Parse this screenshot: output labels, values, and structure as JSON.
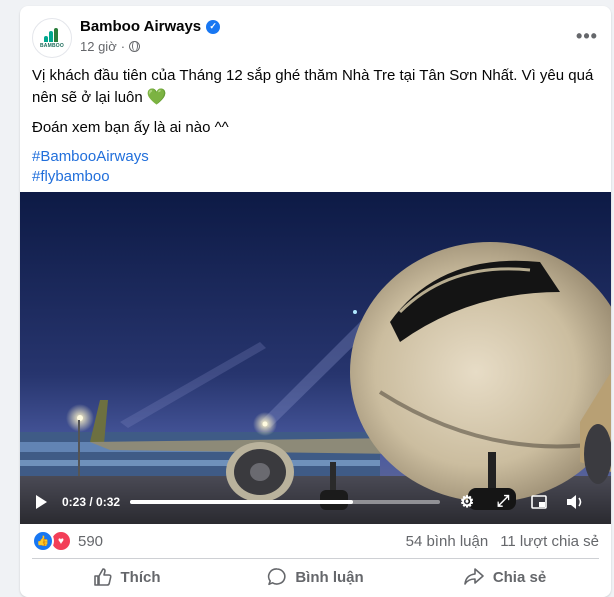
{
  "post": {
    "page_name": "Bamboo Airways",
    "logo_text": "BAMBOO",
    "time": "12 giờ",
    "separator": "·",
    "more": "•••",
    "text_line1": "Vị khách đầu tiên của Tháng 12 sắp ghé thăm Nhà Tre tại Tân Sơn Nhất. Vì yêu quá nên sẽ ở lại luôn",
    "heart": "💚",
    "text_line2": "Đoán xem bạn ấy là ai nào ^^",
    "hashtags": [
      "#BambooAirways",
      "#flybamboo"
    ]
  },
  "video": {
    "current_time": "0:23",
    "duration": "0:32",
    "time_display": "0:23 / 0:32",
    "progress": 0.72
  },
  "stats": {
    "reactions_count": "590",
    "comments": "54 bình luận",
    "shares": "11 lượt chia sẻ"
  },
  "actions": {
    "like": "Thích",
    "comment": "Bình luận",
    "share": "Chia sẻ"
  },
  "icons": [
    "verified-badge-icon",
    "globe-icon",
    "more-options-icon",
    "play-icon",
    "settings-icon",
    "fullscreen-icon",
    "pip-icon",
    "volume-icon",
    "like-reaction-icon",
    "love-reaction-icon",
    "thumbs-up-icon",
    "comment-icon",
    "share-icon"
  ],
  "colors": {
    "accent_blue": "#1877f2",
    "hashtag": "#216fdb",
    "secondary_text": "#65676b",
    "love": "#f33e58",
    "heart_green": "#2ebd3f"
  }
}
